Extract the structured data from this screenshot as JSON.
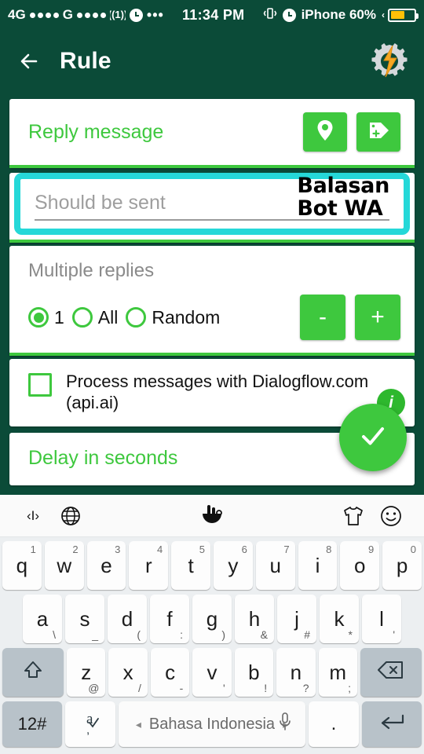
{
  "status_bar": {
    "network": "4G",
    "second_network": "G",
    "time": "11:34 PM",
    "battery_label": "iPhone 60%",
    "battery_percent": 60,
    "icons": [
      "signal-dots-icon",
      "hotspot-icon",
      "alarm-clock-icon",
      "more-dots-icon",
      "vibrate-icon",
      "alarm-clock-icon",
      "battery-icon"
    ]
  },
  "app_bar": {
    "title": "Rule",
    "back_icon": "back-arrow-icon",
    "action_icon": "tasker-gear-icon"
  },
  "reply_card": {
    "title": "Reply message",
    "location_button_icon": "location-pin-icon",
    "tag_button_icon": "tag-plus-icon"
  },
  "message_input": {
    "placeholder": "Should be sent",
    "value": "",
    "annotation_line1": "Balasan",
    "annotation_line2": "Bot WA",
    "highlight_color": "#25d8d8"
  },
  "multiple_replies": {
    "title": "Multiple replies",
    "options": [
      {
        "label": "1",
        "selected": true
      },
      {
        "label": "All",
        "selected": false
      },
      {
        "label": "Random",
        "selected": false
      }
    ],
    "minus_label": "-",
    "plus_label": "+"
  },
  "dialogflow": {
    "label": "Process messages with Dialogflow.com (api.ai)",
    "checked": false,
    "info_label": "i"
  },
  "delay_card": {
    "title": "Delay in seconds"
  },
  "fab": {
    "icon": "check-icon"
  },
  "colors": {
    "app_background": "#0b4b38",
    "accent_green": "#3ec83e",
    "highlight_cyan": "#25d8d8",
    "battery_yellow": "#ffc107"
  },
  "keyboard": {
    "toolbar": [
      {
        "icon": "cursor-move-icon",
        "name": "cursor-move"
      },
      {
        "icon": "globe-icon",
        "name": "language-globe"
      },
      {
        "icon": "touchpal-logo-icon",
        "name": "touchpal-logo"
      },
      {
        "icon": "tshirt-theme-icon",
        "name": "theme"
      },
      {
        "icon": "emoji-smiley-icon",
        "name": "emoji"
      }
    ],
    "row1": [
      {
        "key": "q",
        "hint": "1"
      },
      {
        "key": "w",
        "hint": "2"
      },
      {
        "key": "e",
        "hint": "3"
      },
      {
        "key": "r",
        "hint": "4"
      },
      {
        "key": "t",
        "hint": "5"
      },
      {
        "key": "y",
        "hint": "6"
      },
      {
        "key": "u",
        "hint": "7"
      },
      {
        "key": "i",
        "hint": "8"
      },
      {
        "key": "o",
        "hint": "9"
      },
      {
        "key": "p",
        "hint": "0"
      }
    ],
    "row2": [
      {
        "key": "a",
        "hint": "\\"
      },
      {
        "key": "s",
        "hint": "_"
      },
      {
        "key": "d",
        "hint": "("
      },
      {
        "key": "f",
        "hint": ":"
      },
      {
        "key": "g",
        "hint": ")"
      },
      {
        "key": "h",
        "hint": "&"
      },
      {
        "key": "j",
        "hint": "#"
      },
      {
        "key": "k",
        "hint": "*"
      },
      {
        "key": "l",
        "hint": "'"
      }
    ],
    "row3": [
      {
        "key": "z",
        "hint": "@"
      },
      {
        "key": "x",
        "hint": "/"
      },
      {
        "key": "c",
        "hint": "-"
      },
      {
        "key": "v",
        "hint": "'"
      },
      {
        "key": "b",
        "hint": "!"
      },
      {
        "key": "n",
        "hint": "?"
      },
      {
        "key": "m",
        "hint": ";"
      }
    ],
    "shift_icon": "shift-arrow-icon",
    "backspace_icon": "backspace-icon",
    "numeric_key": "12#",
    "symbol_key": "a",
    "symbol_key_hint": ",",
    "space_label": "Bahasa Indonesia",
    "space_arrow_left": "◂",
    "space_arrow_right": "▸",
    "mic_icon": "microphone-icon",
    "period_key": ".",
    "enter_icon": "enter-return-icon"
  }
}
